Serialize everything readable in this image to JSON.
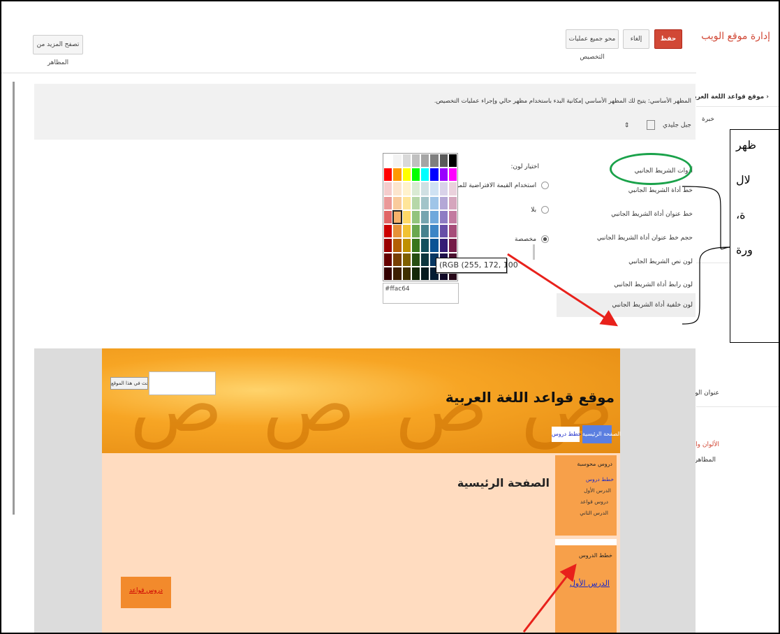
{
  "topbar": {
    "title": "إدارة موقع الويب",
    "save": "حفظ",
    "cancel": "إلغاء",
    "clear_custom": "محو جميع عمليات التخصيص",
    "browse_more": "تصفح المزيد من المظاهر"
  },
  "sidebar": {
    "back_link": "‹ موقع قواعد اللغة العربية",
    "partial_item": "خبرة",
    "site_title": "عنوان الويب",
    "colors_fonts": "الألوان والخطوط",
    "themes": "المظاهر"
  },
  "base_theme": {
    "heading": "المظهر الأساسي: يتيح لك المظهر الأساسي إمكانية البدء باستخدام مظهر حالي وإجراء عمليات التخصيص.",
    "select_value": "جبل جليدي"
  },
  "options": {
    "items": [
      "أدوات الشريط الجانبي",
      "خط أداة الشريط الجانبي",
      "خط عنوان أداة الشريط الجانبي",
      "حجم خط عنوان أداة الشريط الجانبي",
      "لون نص الشريط الجانبي",
      "لون رابط أداة الشريط الجانبي",
      "لون خلفية أداة الشريط الجانبي"
    ]
  },
  "color_picker": {
    "label": "اختيار لون:",
    "opt_default": "استخدام القيمة الافتراضية للموضوع",
    "opt_none": "بلا",
    "opt_custom": "مخصصة",
    "tooltip": "(RGB (255, 172, 100",
    "hex_value": "#ffac64",
    "selected": "custom",
    "colors": [
      "#ffffff",
      "#f3f3f3",
      "#d9d9d9",
      "#c0c0c0",
      "#a5a5a5",
      "#7f7f7f",
      "#595959",
      "#000000",
      "#ff0000",
      "#ff9900",
      "#ffff00",
      "#00ff00",
      "#00ffff",
      "#0000ff",
      "#9900ff",
      "#ff00ff",
      "#f4cccc",
      "#fce5cd",
      "#fff2cc",
      "#d9ead3",
      "#d0e0e3",
      "#cfe2f3",
      "#d9d2e9",
      "#ead1dc",
      "#ea9999",
      "#f9cb9c",
      "#ffe599",
      "#b6d7a8",
      "#a2c4c9",
      "#9fc5e8",
      "#b4a7d6",
      "#d5a6bd",
      "#e06666",
      "#f6b26b",
      "#ffd966",
      "#93c47d",
      "#76a5af",
      "#6fa8dc",
      "#8e7cc3",
      "#c27ba0",
      "#cc0000",
      "#e69138",
      "#f1c232",
      "#6aa84f",
      "#45818e",
      "#3d85c6",
      "#674ea7",
      "#a64d79",
      "#990000",
      "#b45f06",
      "#bf9000",
      "#38761d",
      "#134f5c",
      "#0b5394",
      "#351c75",
      "#741b47",
      "#660000",
      "#783f04",
      "#7f6000",
      "#274e13",
      "#0c343d",
      "#073763",
      "#20124d",
      "#4c1130",
      "#330000",
      "#3d1f02",
      "#3f3000",
      "#142808",
      "#061a1e",
      "#031c33",
      "#100927",
      "#260818"
    ]
  },
  "preview": {
    "site_title": "موقع قواعد اللغة العربية",
    "search_button": "بحث في هذا الموقع",
    "nav_home": "الصفحة الرئيسية",
    "nav_plans": "خطط دروس",
    "page_title": "الصفحة الرئيسية",
    "side_heading": "دروس محوسبة",
    "side_links": [
      "خطط دروس",
      "الدرس الأول",
      "دروس قواعد",
      "الدرس الثاني"
    ],
    "box2_heading": "خطط الدروس",
    "box2_link": "الدرس الأول",
    "bottom_box": "دروس قواعد"
  },
  "callout": {
    "lines": [
      "ظهر",
      "لال",
      "ة،",
      "ورة"
    ]
  },
  "colors": {
    "accent_red": "#d14836",
    "annotation_red": "#e8211b",
    "annotation_green": "#1aa24a",
    "link_blue": "#1a28c8"
  }
}
